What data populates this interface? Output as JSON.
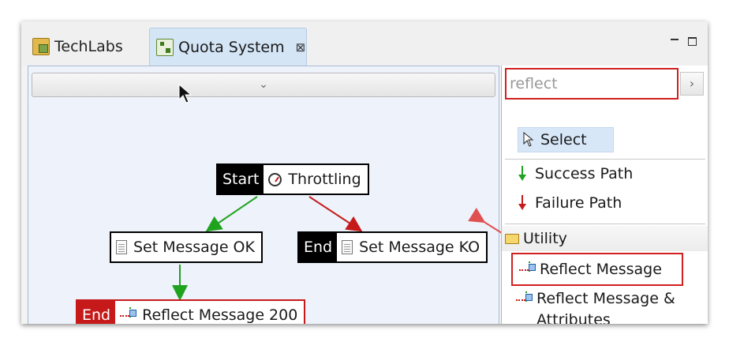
{
  "tabs": [
    {
      "label": "TechLabs",
      "icon": "policy-folder-icon"
    },
    {
      "label": "Quota System",
      "icon": "policy-flow-icon",
      "close": "⊠"
    }
  ],
  "canvas": {
    "collapse_glyph": "⌄",
    "nodes": {
      "start": {
        "tag": "Start",
        "label": "Throttling"
      },
      "set_ok": {
        "label": "Set Message OK"
      },
      "set_ko": {
        "tag": "End",
        "label": "Set Message KO"
      },
      "reflect": {
        "tag": "End",
        "label": "Reflect Message 200"
      }
    },
    "colors": {
      "success": "#1fa31f",
      "failure": "#c61a1a",
      "end_red": "#c61a1a"
    }
  },
  "palette": {
    "search": {
      "value": "reflect",
      "go_glyph": "›"
    },
    "select_label": "Select",
    "success_label": "Success Path",
    "failure_label": "Failure Path",
    "drawer_label": "Utility",
    "reflect_label": "Reflect Message",
    "reflect_attr_label": "Reflect Message & Attributes"
  }
}
